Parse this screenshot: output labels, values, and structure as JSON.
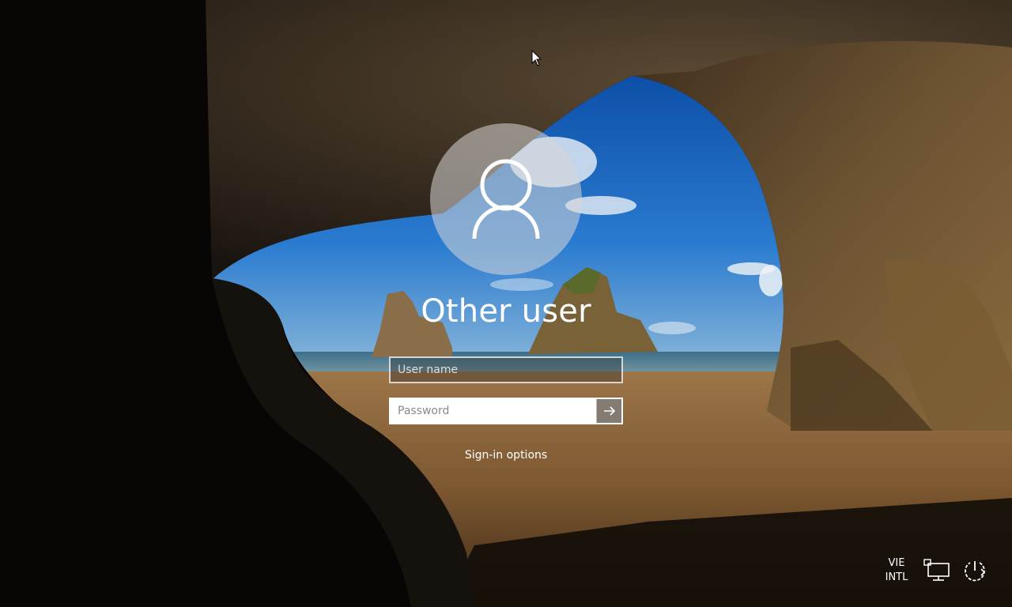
{
  "user": {
    "display_name": "Other user"
  },
  "login": {
    "username_placeholder": "User name",
    "username_value": "",
    "password_placeholder": "Password",
    "password_value": "",
    "submit_icon": "arrow-right-icon",
    "signin_options_label": "Sign-in options"
  },
  "tray": {
    "language_line1": "VIE",
    "language_line2": "INTL",
    "network_icon": "network-icon",
    "power_icon": "power-icon"
  },
  "colors": {
    "text": "#ffffff",
    "avatar_bg": "#d7d7d7",
    "field_border": "#ffffff",
    "submit_bg": "#6e645a"
  }
}
